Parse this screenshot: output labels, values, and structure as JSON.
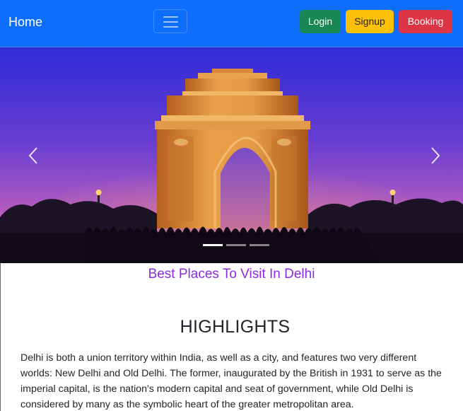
{
  "navbar": {
    "brand": "Home",
    "toggler_icon": "hamburger-icon",
    "buttons": {
      "login": "Login",
      "signup": "Signup",
      "booking": "Booking"
    }
  },
  "carousel": {
    "image": "india-gate-at-dusk",
    "prev_icon": "chevron-left-icon",
    "next_icon": "chevron-right-icon",
    "slide_count": 3,
    "active_slide": 1
  },
  "content": {
    "subtitle": "Best Places To Visit In Delhi",
    "heading": "HIGHLIGHTS",
    "paragraph": "Delhi is both a union territory within India, as well as a city, and features two very different worlds: New Delhi and Old Delhi. The former, inaugurated by the British in 1931 to serve as the imperial capital, is the nation's modern capital and seat of government, while Old Delhi is considered by many as the symbolic heart of the greater metropolitan area."
  },
  "colors": {
    "navbar": "#0d6efd",
    "login": "#198754",
    "signup": "#ffc107",
    "booking": "#dc3545",
    "subtitle": "#8a2be2"
  }
}
